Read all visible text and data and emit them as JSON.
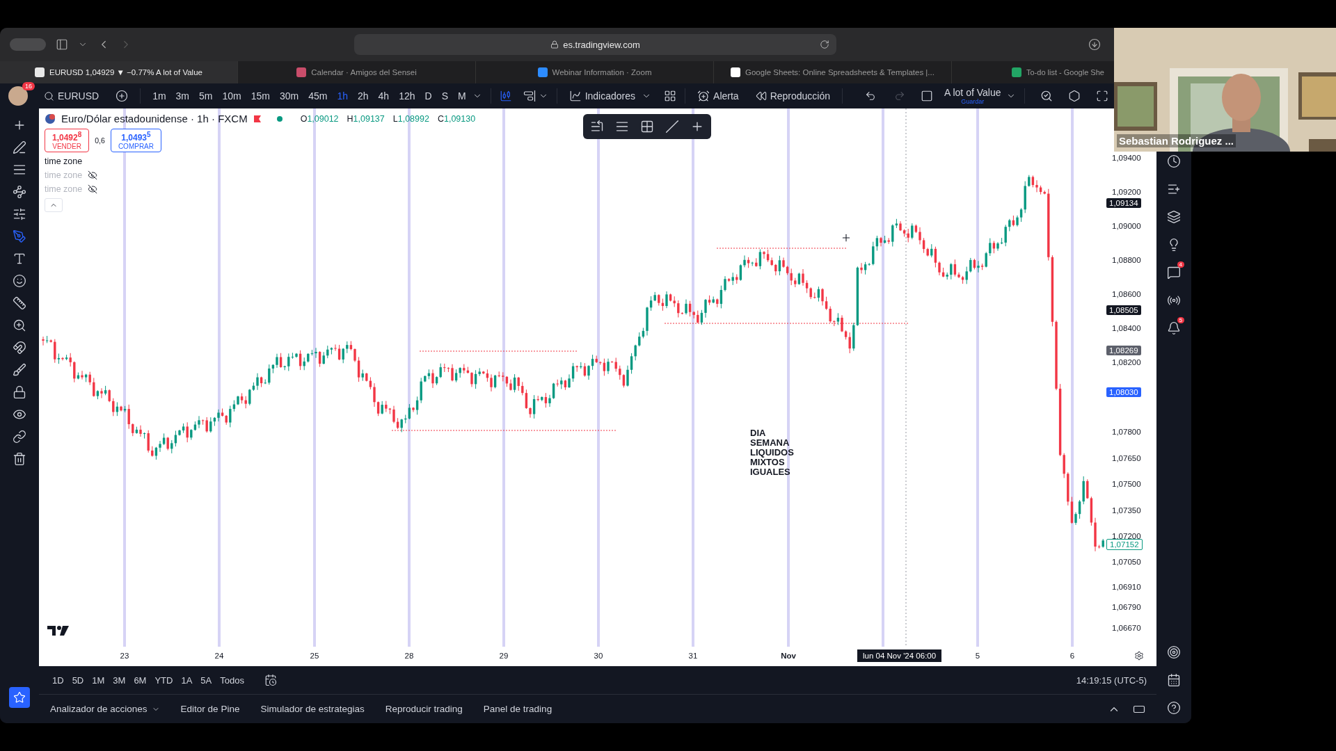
{
  "browser": {
    "address": "es.tradingview.com",
    "tabs": [
      {
        "title": "EURUSD 1,04929 ▼ −0.77% A lot of Value",
        "selected": true
      },
      {
        "title": "Calendar · Amigos del Sensei",
        "selected": false
      },
      {
        "title": "Webinar Information · Zoom",
        "selected": false
      },
      {
        "title": "Google Sheets: Online Spreadsheets & Templates |...",
        "selected": false
      },
      {
        "title": "To-do list - Google She",
        "selected": false
      }
    ]
  },
  "toolbar": {
    "notifications": "16",
    "symbol": "EURUSD",
    "intervals": [
      {
        "label": "1m",
        "selected": false
      },
      {
        "label": "3m",
        "selected": false
      },
      {
        "label": "5m",
        "selected": false
      },
      {
        "label": "10m",
        "selected": false
      },
      {
        "label": "15m",
        "selected": false
      },
      {
        "label": "30m",
        "selected": false
      },
      {
        "label": "45m",
        "selected": false
      },
      {
        "label": "1h",
        "selected": true
      },
      {
        "label": "2h",
        "selected": false
      },
      {
        "label": "4h",
        "selected": false
      },
      {
        "label": "12h",
        "selected": false
      },
      {
        "label": "D",
        "selected": false
      },
      {
        "label": "S",
        "selected": false
      },
      {
        "label": "M",
        "selected": false
      }
    ],
    "indicators": "Indicadores",
    "alert": "Alerta",
    "replay": "Reproducción",
    "layout": {
      "name": "A lot of Value",
      "action": "Guardar"
    }
  },
  "legend": {
    "title": "Euro/Dólar estadounidense · 1h · FXCM",
    "ohlc": [
      {
        "label": "O",
        "value": "1,09012"
      },
      {
        "label": "H",
        "value": "1,09137"
      },
      {
        "label": "L",
        "value": "1,08992"
      },
      {
        "label": "C",
        "value": "1,09130"
      }
    ],
    "sell": {
      "price": "1,0492$^{8}$",
      "label": "VENDER"
    },
    "spread": "0,6",
    "buy": {
      "price": "1,0493$^{5}$",
      "label": "COMPRAR"
    },
    "indicators": [
      {
        "name": "time zone",
        "hidden": false
      },
      {
        "name": "time zone",
        "hidden": true
      },
      {
        "name": "time zone",
        "hidden": true
      }
    ]
  },
  "chart": {
    "annotation": "DIA\nSEMANA\nLIQUIDOS\nMIXTOS\nIGUALES",
    "price_axis": [
      "1,09400",
      "1,09200",
      "1,09000",
      "1,08800",
      "1,08600",
      "1,08400",
      "1,08200",
      "1,07800",
      "1,07650",
      "1,07500",
      "1,07350",
      "1,07200",
      "1,07050",
      "1,06910",
      "1,06790",
      "1,06670"
    ],
    "price_marks": [
      {
        "text": "1,09134",
        "kind": "dark"
      },
      {
        "text": "1,08505",
        "kind": "dark"
      },
      {
        "text": "1,08269",
        "kind": "grey"
      },
      {
        "text": "1,08030",
        "kind": "blue"
      },
      {
        "text": "1,07152",
        "kind": "outline"
      }
    ],
    "time_axis": [
      {
        "label": "23",
        "major": false
      },
      {
        "label": "24",
        "major": false
      },
      {
        "label": "25",
        "major": false
      },
      {
        "label": "28",
        "major": false
      },
      {
        "label": "29",
        "major": false
      },
      {
        "label": "30",
        "major": false
      },
      {
        "label": "31",
        "major": false
      },
      {
        "label": "Nov",
        "major": true
      },
      {
        "label": "5",
        "major": false
      },
      {
        "label": "6",
        "major": false
      }
    ],
    "crosshair_time": "lun 04 Nov '24 06:00"
  },
  "right_sidebar": {
    "chat_badge": "4",
    "alerts_badge": "5"
  },
  "range_bar": {
    "ranges": [
      "1D",
      "5D",
      "1M",
      "3M",
      "6M",
      "YTD",
      "1A",
      "5A",
      "Todos"
    ],
    "clock": "14:19:15 (UTC-5)"
  },
  "bottom_panel": {
    "tabs": [
      "Analizador de acciones",
      "Editor de Pine",
      "Simulador de estrategias",
      "Reproducir trading",
      "Panel de trading"
    ]
  },
  "video": {
    "name": "Sebastian Rodriguez ..."
  }
}
